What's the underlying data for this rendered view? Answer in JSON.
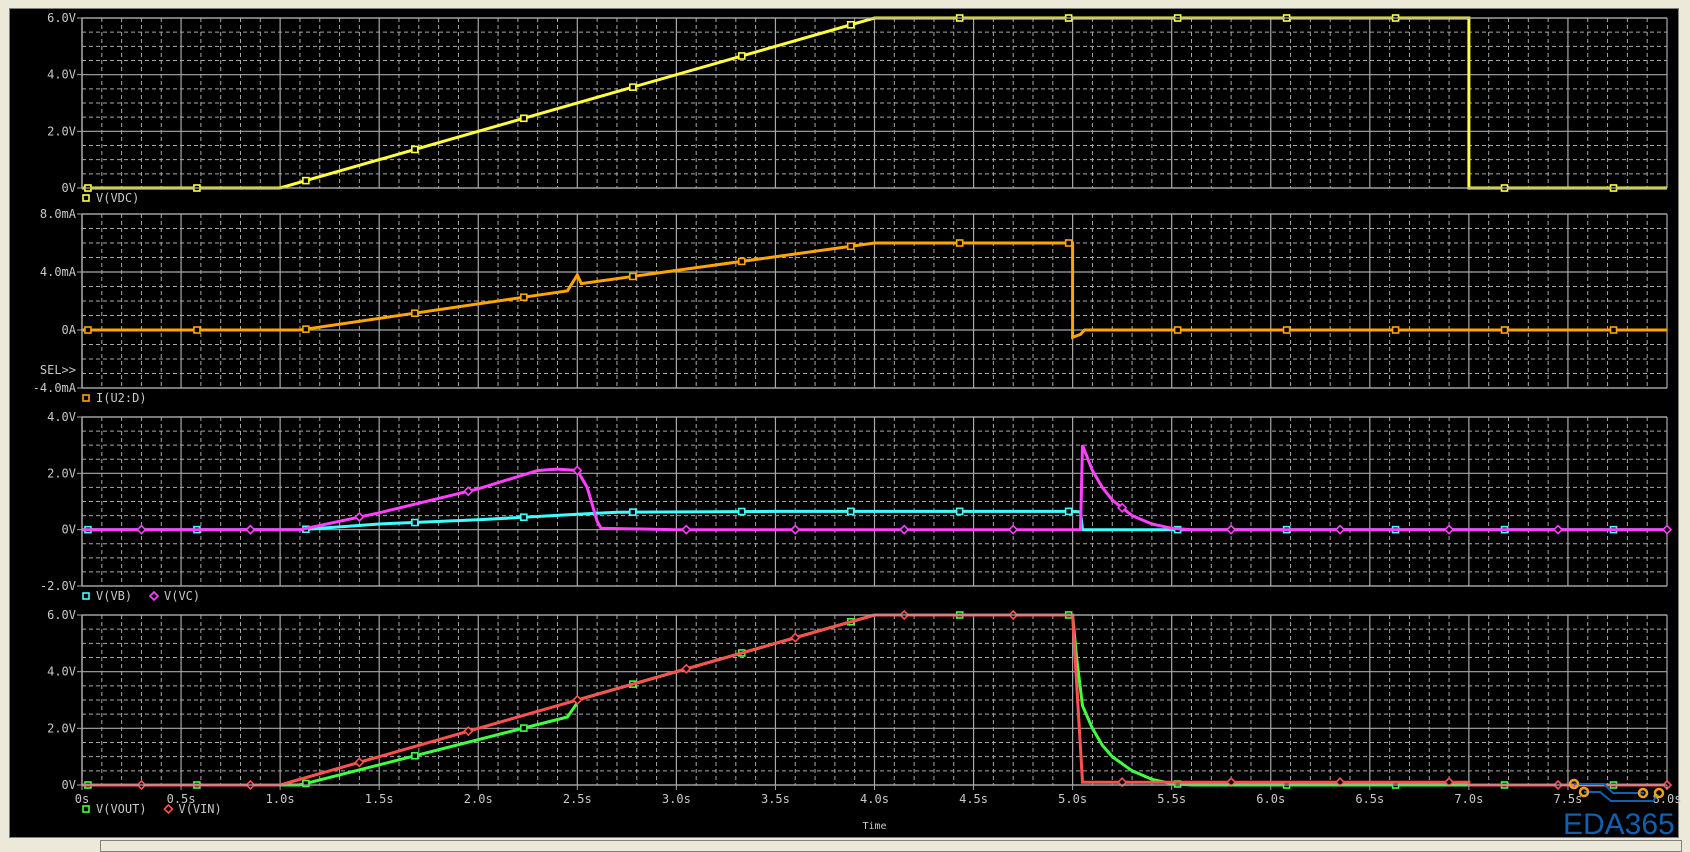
{
  "chart_data": {
    "type": "line",
    "xlabel": "Time",
    "xlim": [
      0,
      8
    ],
    "x_tick_labels": [
      "0s",
      "0.5s",
      "1.0s",
      "1.5s",
      "2.0s",
      "2.5s",
      "3.0s",
      "3.5s",
      "4.0s",
      "4.5s",
      "5.0s",
      "5.5s",
      "6.0s",
      "6.5s",
      "7.0s",
      "7.5s",
      "8.0s"
    ],
    "grid": true,
    "panels": [
      {
        "ylim": [
          0,
          6
        ],
        "y_ticks": [
          {
            "v": 0,
            "label": "0V"
          },
          {
            "v": 2,
            "label": "2.0V"
          },
          {
            "v": 4,
            "label": "4.0V"
          },
          {
            "v": 6,
            "label": "6.0V"
          }
        ],
        "y_minor_step": 0.5,
        "series": [
          {
            "name": "V(VDC)",
            "color": "#ffff40",
            "marker": "square",
            "points": [
              [
                0,
                0
              ],
              [
                1,
                0
              ],
              [
                4,
                6
              ],
              [
                7,
                6
              ],
              [
                7,
                0
              ],
              [
                8,
                0
              ]
            ]
          }
        ]
      },
      {
        "ylim": [
          -4,
          8
        ],
        "y_ticks": [
          {
            "v": -4,
            "label": "-4.0mA"
          },
          {
            "v": 0,
            "label": "0A"
          },
          {
            "v": 4,
            "label": "4.0mA"
          },
          {
            "v": 8,
            "label": "8.0mA"
          }
        ],
        "y_minor_step": 1,
        "selected_label": "SEL>>",
        "series": [
          {
            "name": "I(U2:D)",
            "color": "#ffa500",
            "marker": "square",
            "points": [
              [
                0,
                0
              ],
              [
                1.1,
                0
              ],
              [
                2.4,
                2.6
              ],
              [
                2.45,
                2.7
              ],
              [
                2.5,
                3.8
              ],
              [
                2.52,
                3.2
              ],
              [
                4.0,
                6.0
              ],
              [
                5.0,
                6.0
              ],
              [
                5.0,
                -0.5
              ],
              [
                5.04,
                -0.3
              ],
              [
                5.06,
                0
              ],
              [
                8,
                0
              ]
            ]
          }
        ]
      },
      {
        "ylim": [
          -2,
          4
        ],
        "y_ticks": [
          {
            "v": -2,
            "label": "-2.0V"
          },
          {
            "v": 0,
            "label": "0V"
          },
          {
            "v": 2,
            "label": "2.0V"
          },
          {
            "v": 4,
            "label": "4.0V"
          }
        ],
        "y_minor_step": 0.5,
        "series": [
          {
            "name": "V(VB)",
            "color": "#40ffff",
            "marker": "square",
            "points": [
              [
                0,
                0
              ],
              [
                1.1,
                0
              ],
              [
                1.5,
                0.2
              ],
              [
                2.0,
                0.35
              ],
              [
                2.5,
                0.55
              ],
              [
                2.7,
                0.62
              ],
              [
                3.5,
                0.65
              ],
              [
                5.0,
                0.65
              ],
              [
                5.04,
                0.63
              ],
              [
                5.05,
                0
              ],
              [
                8,
                0
              ]
            ]
          },
          {
            "name": "V(VC)",
            "color": "#ff40ff",
            "marker": "diamond",
            "points": [
              [
                0,
                0
              ],
              [
                1.1,
                0
              ],
              [
                1.5,
                0.6
              ],
              [
                2.0,
                1.45
              ],
              [
                2.3,
                2.1
              ],
              [
                2.4,
                2.15
              ],
              [
                2.5,
                2.1
              ],
              [
                2.55,
                1.5
              ],
              [
                2.6,
                0.3
              ],
              [
                2.62,
                0.05
              ],
              [
                3.0,
                0
              ],
              [
                5.04,
                0
              ],
              [
                5.05,
                3.0
              ],
              [
                5.1,
                2.1
              ],
              [
                5.15,
                1.5
              ],
              [
                5.2,
                1.05
              ],
              [
                5.3,
                0.5
              ],
              [
                5.4,
                0.2
              ],
              [
                5.5,
                0.05
              ],
              [
                5.6,
                0
              ],
              [
                8,
                0
              ]
            ]
          }
        ]
      },
      {
        "ylim": [
          0,
          6
        ],
        "y_ticks": [
          {
            "v": 0,
            "label": "0V"
          },
          {
            "v": 2,
            "label": "2.0V"
          },
          {
            "v": 4,
            "label": "4.0V"
          },
          {
            "v": 6,
            "label": "6.0V"
          }
        ],
        "y_minor_step": 0.5,
        "series": [
          {
            "name": "V(VOUT)",
            "color": "#40ff40",
            "marker": "square",
            "points": [
              [
                0,
                0
              ],
              [
                1.1,
                0
              ],
              [
                2.45,
                2.4
              ],
              [
                2.5,
                2.9
              ],
              [
                2.52,
                3.04
              ],
              [
                4,
                6
              ],
              [
                5,
                6
              ],
              [
                5.02,
                4.5
              ],
              [
                5.05,
                2.8
              ],
              [
                5.1,
                2.0
              ],
              [
                5.15,
                1.4
              ],
              [
                5.2,
                1.0
              ],
              [
                5.3,
                0.5
              ],
              [
                5.4,
                0.2
              ],
              [
                5.5,
                0.05
              ],
              [
                5.6,
                0
              ],
              [
                8,
                0
              ]
            ]
          },
          {
            "name": "V(VIN)",
            "color": "#ff5050",
            "marker": "diamond",
            "points": [
              [
                0,
                0
              ],
              [
                1,
                0
              ],
              [
                4,
                6
              ],
              [
                5,
                6
              ],
              [
                5.05,
                0.1
              ],
              [
                7,
                0.1
              ],
              [
                7,
                0
              ],
              [
                8,
                0
              ]
            ]
          }
        ]
      }
    ]
  },
  "watermark": {
    "text": "EDA365",
    "color": "#1060b0"
  },
  "colors": {
    "background": "#000000",
    "grid": "#a8a8a8",
    "frame": "#ece9d8"
  }
}
